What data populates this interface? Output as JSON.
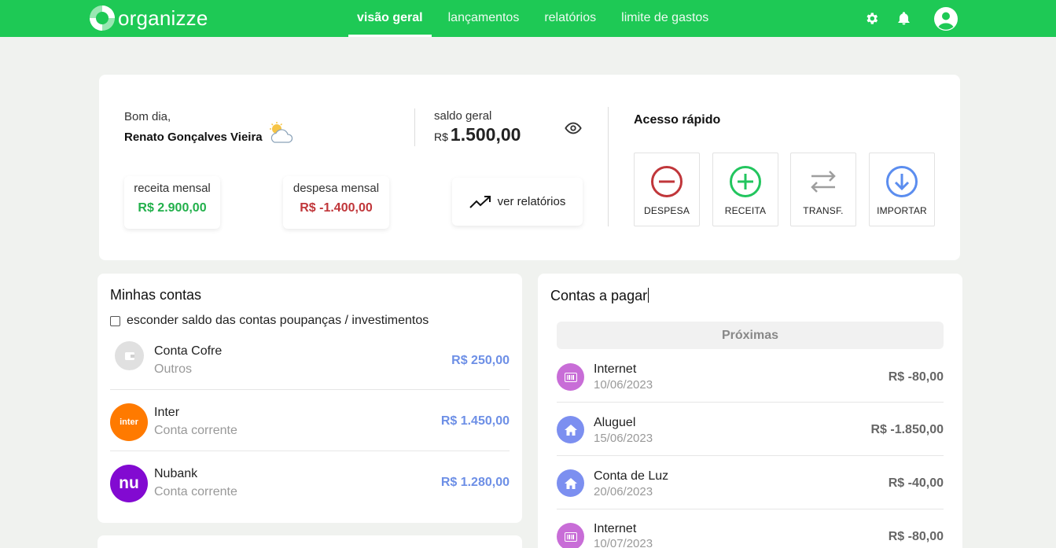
{
  "app": {
    "logo_text": "organizze"
  },
  "nav": {
    "items": [
      {
        "label": "visão geral",
        "active": true
      },
      {
        "label": "lançamentos",
        "active": false
      },
      {
        "label": "relatórios",
        "active": false
      },
      {
        "label": "limite de gastos",
        "active": false
      }
    ],
    "icons": [
      "gear-icon",
      "bell-icon",
      "user-avatar-icon"
    ]
  },
  "summary": {
    "greeting": "Bom dia,",
    "user_name": "Renato Gonçalves Vieira",
    "weather_icon": "partly-cloudy-icon",
    "saldo_label": "saldo geral",
    "saldo_currency": "R$",
    "saldo_value": "1.500,00",
    "receita_label": "receita mensal",
    "receita_value": "R$ 2.900,00",
    "despesa_label": "despesa mensal",
    "despesa_value": "R$ -1.400,00",
    "relatorios_button": "ver relatórios"
  },
  "quick_access": {
    "title": "Acesso rápido",
    "buttons": [
      {
        "label": "DESPESA",
        "icon": "minus-circle-icon",
        "color": "#c0363a"
      },
      {
        "label": "RECEITA",
        "icon": "plus-circle-icon",
        "color": "#22c55e"
      },
      {
        "label": "TRANSF.",
        "icon": "transfer-arrows-icon",
        "color": "#9e9e9e"
      },
      {
        "label": "IMPORTAR",
        "icon": "download-circle-icon",
        "color": "#5b8def"
      }
    ]
  },
  "accounts": {
    "title": "Minhas contas",
    "hide_savings_label": "esconder saldo das contas poupanças / investimentos",
    "hide_savings_checked": false,
    "items": [
      {
        "name": "Conta Cofre",
        "type": "Outros",
        "balance": "R$ 250,00",
        "logo": "wallet-icon",
        "color": "#e0e0e0"
      },
      {
        "name": "Inter",
        "type": "Conta corrente",
        "balance": "R$ 1.450,00",
        "logo_text": "inter",
        "color": "#ff7a00"
      },
      {
        "name": "Nubank",
        "type": "Conta corrente",
        "balance": "R$ 1.280,00",
        "logo_text": "nu",
        "color": "#820ad1"
      }
    ]
  },
  "bills": {
    "title": "Contas a pagar",
    "tab_label": "Próximas",
    "items": [
      {
        "name": "Internet",
        "date": "10/06/2023",
        "value": "R$ -80,00",
        "icon": "barcode-icon",
        "color": "#c86dd7"
      },
      {
        "name": "Aluguel",
        "date": "15/06/2023",
        "value": "R$ -1.850,00",
        "icon": "house-icon",
        "color": "#7c8ff0"
      },
      {
        "name": "Conta de Luz",
        "date": "20/06/2023",
        "value": "R$ -40,00",
        "icon": "house-icon",
        "color": "#7c8ff0"
      },
      {
        "name": "Internet",
        "date": "10/07/2023",
        "value": "R$ -80,00",
        "icon": "barcode-icon",
        "color": "#c86dd7"
      }
    ]
  },
  "colors": {
    "brand": "#1ec955",
    "income": "#22b04b",
    "expense": "#c0363a",
    "account_balance": "#6d8fe6"
  }
}
